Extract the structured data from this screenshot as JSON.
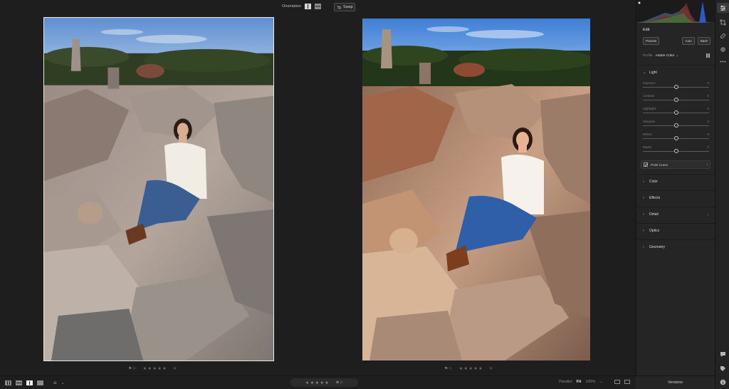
{
  "toolbar": {
    "orientation_label": "Orientation",
    "swap_label": "Swap"
  },
  "meta_before": {
    "flags": "⚑⚐",
    "stars": "★★★★★",
    "reject": "✕"
  },
  "meta_after": {
    "flags": "⚑⚐",
    "stars": "★★★★★",
    "reject": "✕"
  },
  "bottom": {
    "rating_stars": "★★★★★",
    "rating_flags": "⚑⚐",
    "parallel_label": "Parallel",
    "fit_label": "Fit",
    "zoom_label": "100%",
    "zoom_chevron": "⌄",
    "sort_icon": "≡",
    "sort_chevron": "⌄"
  },
  "panel": {
    "title": "Edit",
    "presets_label": "Presets",
    "auto_label": "Auto",
    "bw_label": "B&W",
    "profile_label": "Profile",
    "profile_value": "Adobe Color",
    "profile_chevron": "⌄",
    "light": {
      "label": "Light",
      "sliders": [
        {
          "label": "Exposure",
          "value": "0",
          "position": 0.5
        },
        {
          "label": "Contrast",
          "value": "0",
          "position": 0.5
        },
        {
          "label": "Highlights",
          "value": "0",
          "position": 0.5
        },
        {
          "label": "Shadows",
          "value": "0",
          "position": 0.5
        },
        {
          "label": "Whites",
          "value": "0",
          "position": 0.5
        },
        {
          "label": "Blacks",
          "value": "0",
          "position": 0.5
        }
      ],
      "point_curve_label": "Point Curve"
    },
    "sections": [
      {
        "label": "Color",
        "extra": ""
      },
      {
        "label": "Effects",
        "extra": ""
      },
      {
        "label": "Detail",
        "extra": "◐"
      },
      {
        "label": "Optics",
        "extra": ""
      },
      {
        "label": "Geometry",
        "extra": ""
      }
    ],
    "versions_label": "Versions"
  },
  "icons": {
    "swap": "⇆",
    "caret_down": "⌄",
    "caret_right": "›",
    "chevron_right": "›",
    "strip": [
      "sliders-icon",
      "crop-icon",
      "healing-icon",
      "mask-icon",
      "more-icon",
      "comment-icon",
      "tag-icon",
      "info-icon"
    ]
  }
}
